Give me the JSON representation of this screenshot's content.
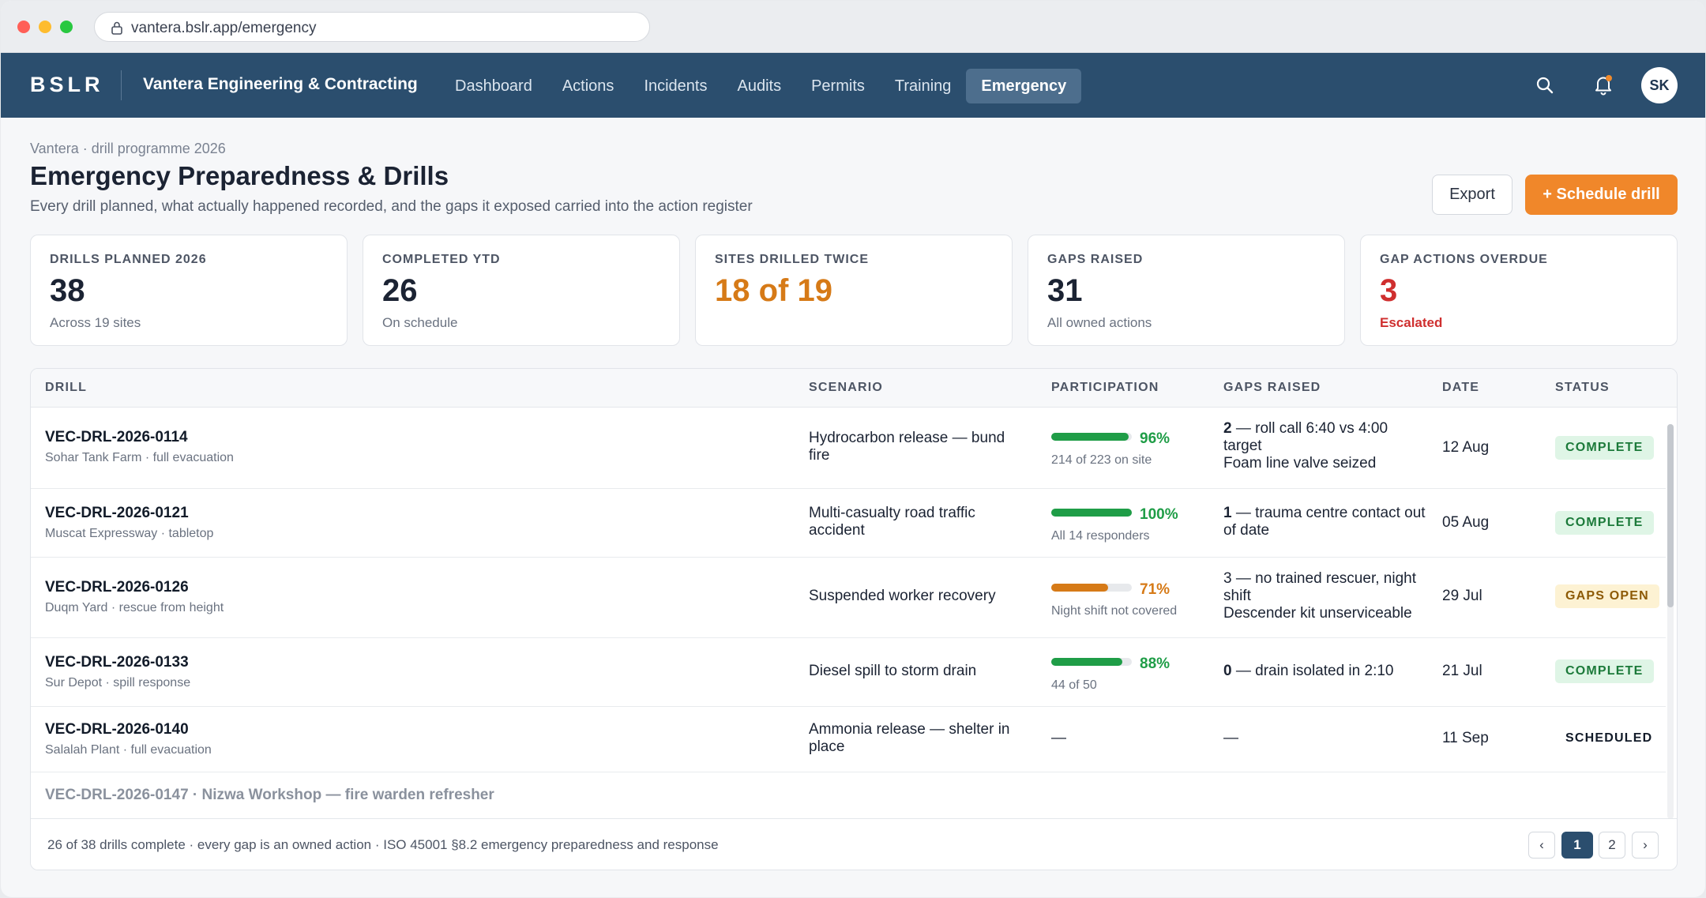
{
  "browser": {
    "url_host": "vantera.bslr.app",
    "url_path": "/emergency"
  },
  "nav": {
    "brand": "BSLR",
    "company": "Vantera Engineering & Contracting",
    "items": [
      {
        "label": "Dashboard",
        "active": false
      },
      {
        "label": "Actions",
        "active": false
      },
      {
        "label": "Incidents",
        "active": false
      },
      {
        "label": "Audits",
        "active": false
      },
      {
        "label": "Permits",
        "active": false
      },
      {
        "label": "Training",
        "active": false
      },
      {
        "label": "Emergency",
        "active": true
      }
    ],
    "avatar_initials": "SK",
    "icons": [
      "search-icon",
      "bell-icon"
    ],
    "accent": "#2b4e6e"
  },
  "header": {
    "breadcrumb": "Vantera · drill programme 2026",
    "title": "Emergency Preparedness & Drills",
    "subtitle": "Every drill planned, what actually happened recorded, and the gaps it exposed carried into the action register",
    "export_label": "Export",
    "schedule_label": "+ Schedule drill"
  },
  "kpis": [
    {
      "label": "Drills planned 2026",
      "value": "38",
      "note": "Across 19 sites"
    },
    {
      "label": "Completed YTD",
      "value": "26",
      "note": "On schedule"
    },
    {
      "label": "Sites drilled twice",
      "value": "18 of 19",
      "note": ""
    },
    {
      "label": "Gaps raised",
      "value": "31",
      "note": "All owned actions"
    },
    {
      "label": "Gap actions overdue",
      "value": "3",
      "note": "Escalated"
    }
  ],
  "table": {
    "columns": [
      "Drill",
      "Scenario",
      "Participation",
      "Gaps raised",
      "Date",
      "Status"
    ],
    "rows": [
      {
        "id": "VEC-DRL-2026-0114",
        "site": "Sohar Tank Farm · full evacuation",
        "scenario": "Hydrocarbon release — bund fire",
        "participation_pct": 96,
        "participation_label": "96%",
        "participation_note": "214 of 223 on site",
        "gaps_count": "2",
        "gaps_text": " — roll call 6:40 vs 4:00 target",
        "gaps_text2": "Foam line valve seized",
        "date": "12 Aug",
        "status": "COMPLETE"
      },
      {
        "id": "VEC-DRL-2026-0121",
        "site": "Muscat Expressway · tabletop",
        "scenario": "Multi-casualty road traffic accident",
        "participation_pct": 100,
        "participation_label": "100%",
        "participation_note": "All 14 responders",
        "gaps_count": "1",
        "gaps_text": " — trauma centre contact out of date",
        "gaps_text2": "",
        "date": "05 Aug",
        "status": "COMPLETE"
      },
      {
        "id": "VEC-DRL-2026-0126",
        "site": "Duqm Yard · rescue from height",
        "scenario": "Suspended worker recovery",
        "participation_pct": 71,
        "participation_label": "71%",
        "participation_note": "Night shift not covered",
        "gaps_count": "",
        "gaps_text": "3 — no trained rescuer, night shift",
        "gaps_text2": "Descender kit unserviceable",
        "date": "29 Jul",
        "status": "GAPS OPEN"
      },
      {
        "id": "VEC-DRL-2026-0133",
        "site": "Sur Depot · spill response",
        "scenario": "Diesel spill to storm drain",
        "participation_pct": 88,
        "participation_label": "88%",
        "participation_note": "44 of 50",
        "gaps_count": "0",
        "gaps_text": " — drain isolated in 2:10",
        "gaps_text2": "",
        "date": "21 Jul",
        "status": "COMPLETE"
      },
      {
        "id": "VEC-DRL-2026-0140",
        "site": "Salalah Plant · full evacuation",
        "scenario": "Ammonia release — shelter in place",
        "participation_dash": "—",
        "gaps_dash": "—",
        "date": "11 Sep",
        "status": "SCHEDULED"
      }
    ],
    "peek_row": "VEC-DRL-2026-0147 · Nizwa Workshop — fire warden refresher",
    "footer": "26 of 38 drills complete · every gap is an owned action · ISO 45001 §8.2 emergency preparedness and response",
    "pagination": {
      "prev": "‹",
      "pages": [
        "1",
        "2"
      ],
      "current": "1",
      "next": "›"
    },
    "colors": {
      "complete": "#1f9d47",
      "partial": "#d67a17"
    }
  }
}
